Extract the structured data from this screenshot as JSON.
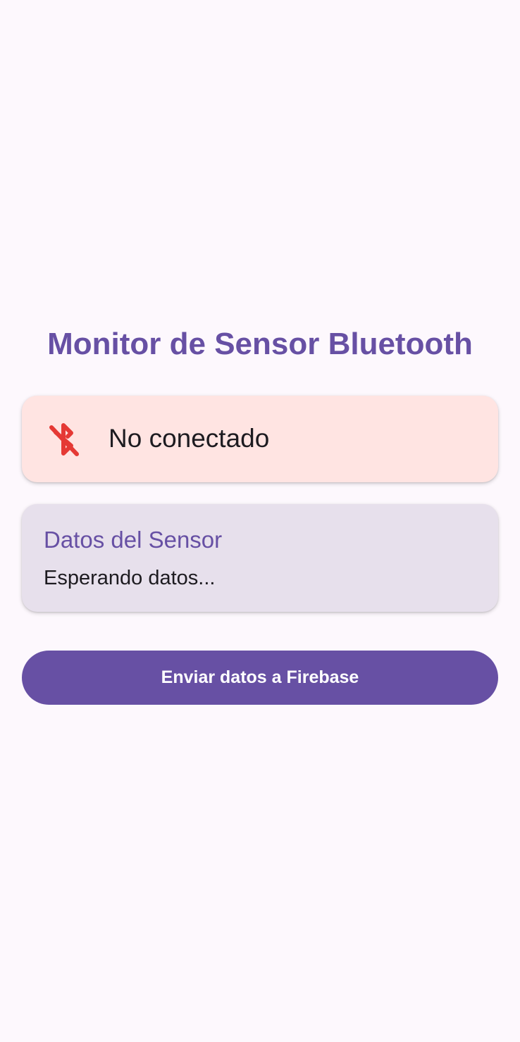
{
  "header": {
    "title": "Monitor de Sensor Bluetooth"
  },
  "connection": {
    "status_text": "No conectado",
    "icon": "bluetooth-disabled-icon",
    "icon_color": "#e53935",
    "card_color": "#ffe4e2"
  },
  "sensor": {
    "title": "Datos del Sensor",
    "value": "Esperando datos...",
    "card_color": "#e7e0ec"
  },
  "actions": {
    "send_label": "Enviar datos a Firebase"
  },
  "colors": {
    "primary": "#6750a4",
    "background": "#fdf8fd",
    "on_surface": "#1d1b20"
  }
}
